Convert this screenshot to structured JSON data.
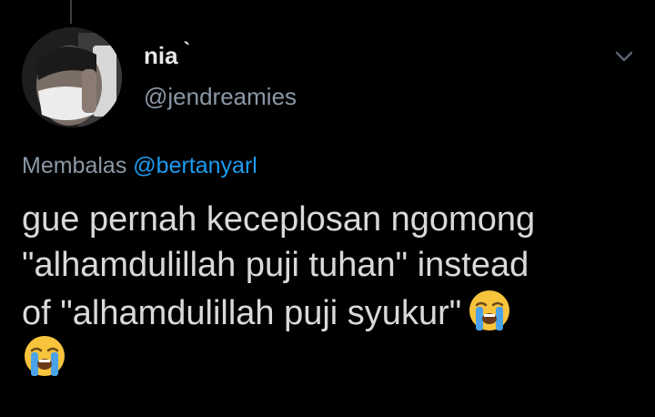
{
  "tweet": {
    "author": {
      "display_name": "nia",
      "name_mark": "`",
      "handle": "@jendreamies"
    },
    "reply_prefix": "Membalas",
    "reply_to": "@bertanyarl",
    "lines": [
      "gue pernah keceplosan ngomong",
      "\"alhamdulillah puji tuhan\" instead",
      "of \"alhamdulillah puji syukur\""
    ],
    "emoji": "loudly-crying-face"
  },
  "colors": {
    "background": "#000000",
    "text": "#d9d9d9",
    "secondary_text": "#8b98a5",
    "accent": "#1d9bf0",
    "emoji_face": "#f8c43c",
    "emoji_tears": "#4aa3e8"
  }
}
